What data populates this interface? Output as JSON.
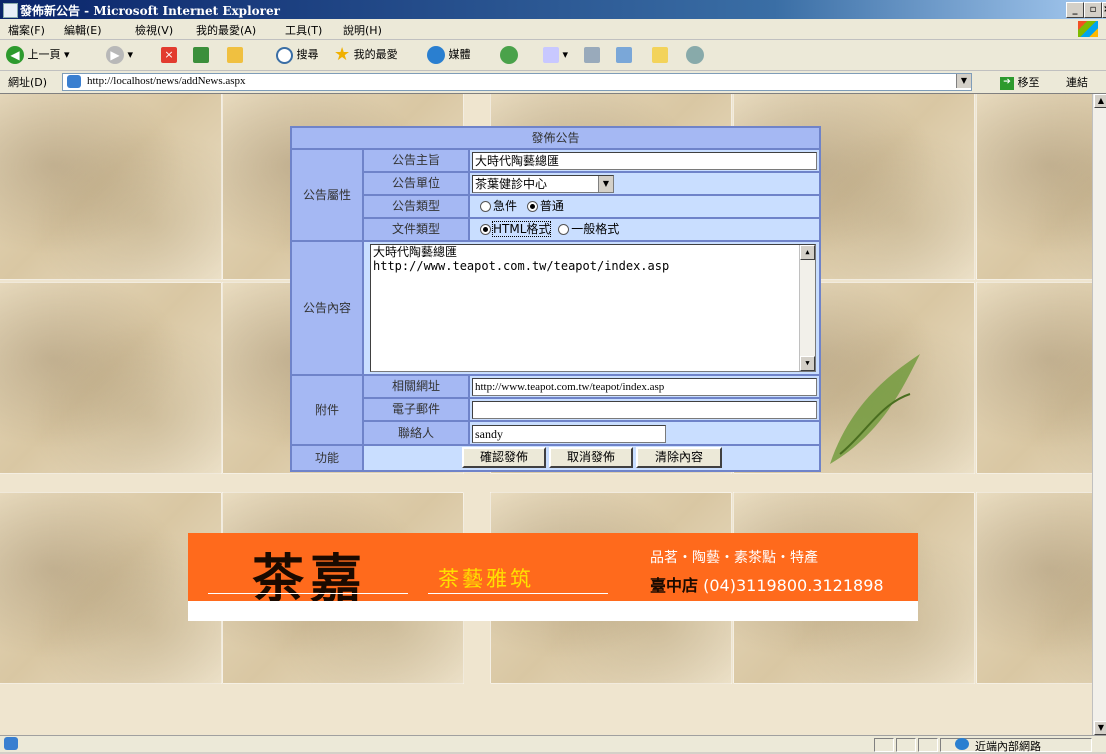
{
  "window": {
    "title": "發佈新公告 - Microsoft Internet Explorer",
    "min": "_",
    "max": "▫",
    "close": "×"
  },
  "menu": [
    "檔案(F)",
    "編輯(E)",
    "檢視(V)",
    "我的最愛(A)",
    "工具(T)",
    "說明(H)"
  ],
  "toolbar": {
    "back": "上一頁",
    "search": "搜尋",
    "favorites": "我的最愛",
    "media": "媒體"
  },
  "address": {
    "label": "網址(D)",
    "url": "http://localhost/news/addNews.aspx",
    "go": "移至",
    "links": "連結"
  },
  "form": {
    "header": "發佈公告",
    "group_attr": "公告屬性",
    "subject_label": "公告主旨",
    "subject_value": "大時代陶藝總匯",
    "unit_label": "公告單位",
    "unit_value": "茶葉健診中心",
    "type_label": "公告類型",
    "type_options": [
      "急件",
      "普通"
    ],
    "type_selected": "普通",
    "doc_label": "文件類型",
    "doc_options": [
      "HTML格式",
      "一般格式"
    ],
    "doc_selected": "HTML格式",
    "content_label": "公告內容",
    "content_lines": [
      "大時代陶藝總匯",
      "http://www.teapot.com.tw/teapot/index.asp"
    ],
    "group_attach": "附件",
    "url_label": "相關網址",
    "url_value": "http://www.teapot.com.tw/teapot/index.asp",
    "email_label": "電子郵件",
    "email_value": "",
    "contact_label": "聯絡人",
    "contact_value": "sandy",
    "func_label": "功能",
    "buttons": [
      "確認發佈",
      "取消發佈",
      "清除內容"
    ]
  },
  "banner": {
    "logo": "茶嘉",
    "slogan": "茶藝雅筑",
    "products": "品茗・陶藝・素茶點・特產",
    "branch": "臺中店",
    "phone": "(04)3119800.3121898",
    "bg_color": "#ff6a1c"
  },
  "status": {
    "zone": "近端內部網路"
  }
}
